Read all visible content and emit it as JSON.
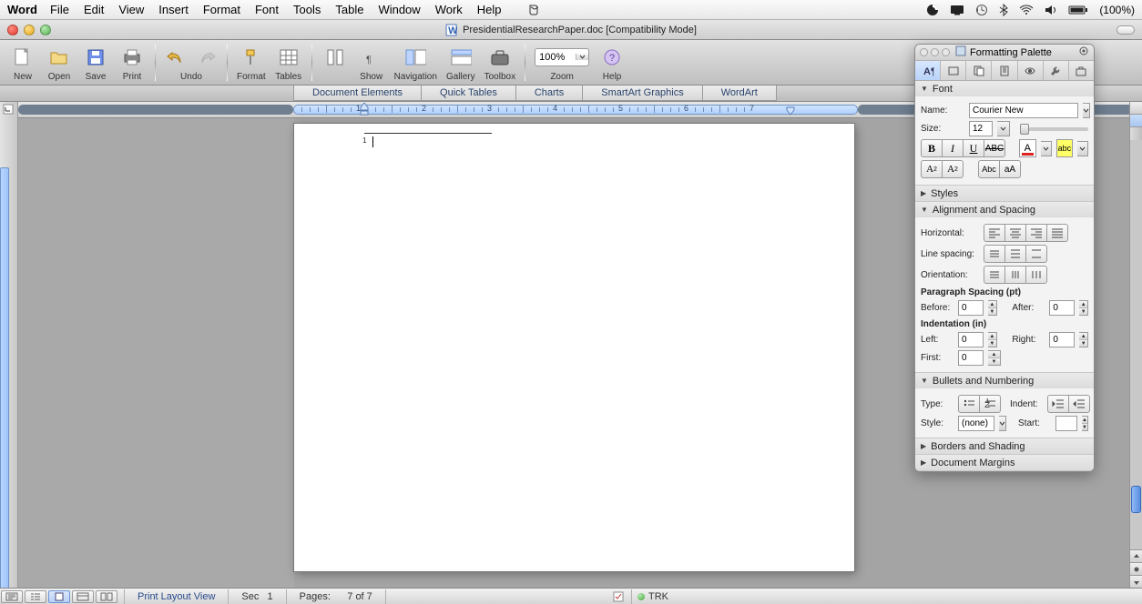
{
  "menubar": {
    "app": "Word",
    "items": [
      "File",
      "Edit",
      "View",
      "Insert",
      "Format",
      "Font",
      "Tools",
      "Table",
      "Window",
      "Work",
      "Help"
    ],
    "battery": "(100%)"
  },
  "window": {
    "title": "PresidentialResearchPaper.doc [Compatibility Mode]"
  },
  "toolbar": {
    "new": "New",
    "open": "Open",
    "save": "Save",
    "print": "Print",
    "undo": "Undo",
    "format": "Format",
    "tables": "Tables",
    "show": "Show",
    "navigation": "Navigation",
    "gallery": "Gallery",
    "toolbox": "Toolbox",
    "zoom": "Zoom",
    "zoom_val": "100%",
    "help": "Help"
  },
  "gallery_tabs": [
    "Document Elements",
    "Quick Tables",
    "Charts",
    "SmartArt Graphics",
    "WordArt"
  ],
  "ruler": {
    "marks": [
      "1",
      "2",
      "3",
      "4",
      "5",
      "6",
      "7"
    ]
  },
  "page": {
    "footnote": "1"
  },
  "status": {
    "view": "Print Layout View",
    "sec_label": "Sec",
    "sec": "1",
    "pages_label": "Pages:",
    "pages": "7 of 7",
    "trk": "TRK"
  },
  "palette": {
    "title": "Formatting Palette",
    "font": {
      "head": "Font",
      "name_label": "Name:",
      "name": "Courier New",
      "size_label": "Size:",
      "size": "12",
      "b": "B",
      "i": "I",
      "u": "U",
      "strike": "ABC",
      "A": "A",
      "hl": "abc",
      "sup": "A",
      "sub": "A",
      "caps": "Abc",
      "aa": "aA"
    },
    "styles_head": "Styles",
    "align": {
      "head": "Alignment and Spacing",
      "horiz": "Horizontal:",
      "linesp": "Line spacing:",
      "orient": "Orientation:",
      "parahdr": "Paragraph Spacing (pt)",
      "before": "Before:",
      "before_v": "0",
      "after": "After:",
      "after_v": "0",
      "indhdr": "Indentation (in)",
      "left": "Left:",
      "left_v": "0",
      "right": "Right:",
      "right_v": "0",
      "first": "First:",
      "first_v": "0"
    },
    "bullets": {
      "head": "Bullets and Numbering",
      "type": "Type:",
      "indent": "Indent:",
      "style": "Style:",
      "style_v": "(none)",
      "start": "Start:"
    },
    "borders_head": "Borders and Shading",
    "margins_head": "Document Margins"
  }
}
